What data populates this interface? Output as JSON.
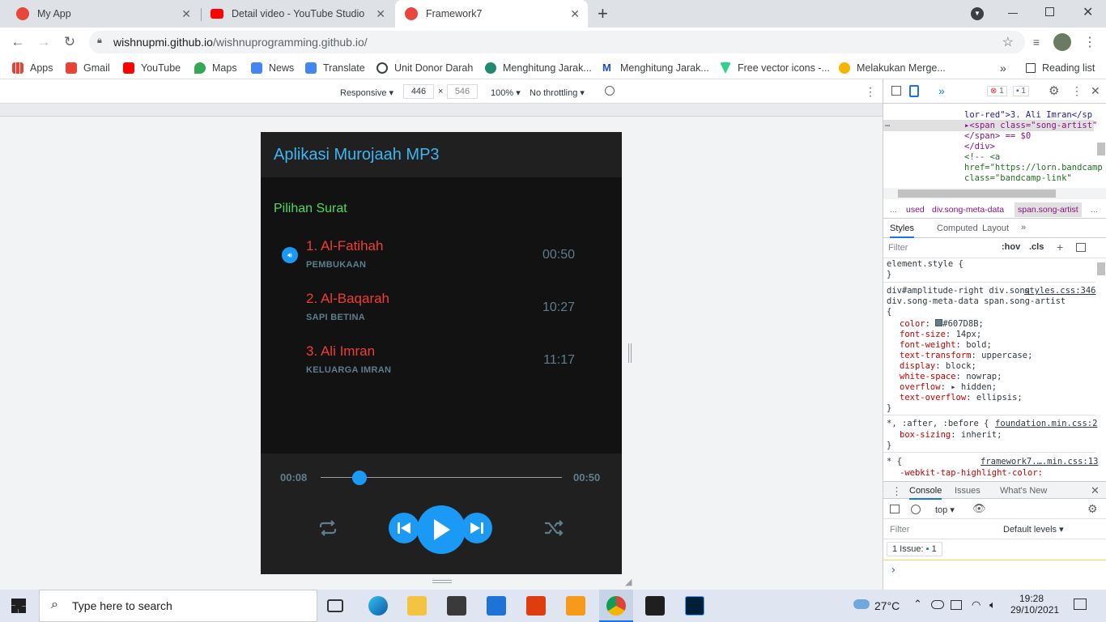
{
  "browser": {
    "tabs": [
      {
        "title": "My App",
        "active": false
      },
      {
        "title": "Detail video - YouTube Studio",
        "active": false
      },
      {
        "title": "Framework7",
        "active": true
      }
    ],
    "new_tab": "+",
    "url_host": "wishnupmi.github.io",
    "url_path": "/wishnuprogramming.github.io/",
    "bookmarks": [
      "Apps",
      "Gmail",
      "YouTube",
      "Maps",
      "News",
      "Translate",
      "Unit Donor Darah",
      "Menghitung Jarak...",
      "Menghitung Jarak...",
      "Free vector icons -...",
      "Melakukan Merge..."
    ],
    "bookmarks_more": "»",
    "reading_list": "Reading list"
  },
  "device_toolbar": {
    "mode": "Responsive ▾",
    "width": "446",
    "times": "×",
    "height": "546",
    "zoom": "100% ▾",
    "throttle": "No throttling ▾"
  },
  "app": {
    "title": "Aplikasi Murojaah MP3",
    "section": "Pilihan Surat",
    "songs": [
      {
        "title": "1. Al-Fatihah",
        "artist": "PEMBUKAAN",
        "duration": "00:50",
        "playing": true
      },
      {
        "title": "2. Al-Baqarah",
        "artist": "SAPI BETINA",
        "duration": "10:27",
        "playing": false
      },
      {
        "title": "3. Ali Imran",
        "artist": "KELUARGA IMRAN",
        "duration": "11:17",
        "playing": false
      }
    ],
    "player": {
      "current_time": "00:08",
      "total_time": "00:50",
      "progress": 0.16
    }
  },
  "devtools": {
    "errors": "1",
    "messages": "1",
    "dom": [
      "lor-red\">3. Ali Imran</sp",
      "▸<span class=\"song-artist\"",
      "</span> == $0",
      "</div>",
      "<!-- <a",
      "href=\"https://lorn.bandcamp",
      "class=\"bandcamp-link\""
    ],
    "breadcrumbs": [
      "...",
      "used",
      "div.song-meta-data",
      "span.song-artist",
      "..."
    ],
    "tabs": [
      "Styles",
      "Computed",
      "Layout",
      "»"
    ],
    "filter_placeholder": "Filter",
    "hov": ":hov",
    "cls": ".cls",
    "element_style": "element.style {",
    "rule1_source": "styles.css:346",
    "rule1_selector": "div#amplitude-right div.song div.song-meta-data span.song-artist {",
    "rule1_props": [
      {
        "name": "color",
        "value": "#607D8B;"
      },
      {
        "name": "font-size",
        "value": "14px;"
      },
      {
        "name": "font-weight",
        "value": "bold;"
      },
      {
        "name": "text-transform",
        "value": "uppercase;"
      },
      {
        "name": "display",
        "value": "block;"
      },
      {
        "name": "white-space",
        "value": "nowrap;"
      },
      {
        "name": "overflow",
        "value": "▸ hidden;"
      },
      {
        "name": "text-overflow",
        "value": "ellipsis;"
      }
    ],
    "rule2_selector": "*, :after, :before {",
    "rule2_source": "foundation.min.css:2",
    "rule2_prop": {
      "name": "box-sizing",
      "value": "inherit;"
    },
    "rule3_selector": "* {",
    "rule3_source": "framework7.….min.css:13",
    "rule3_prop": "-webkit-tap-highlight-color:",
    "close_brace": "}",
    "drawer_tabs": [
      "Console",
      "Issues",
      "What's New"
    ],
    "context": "top ▾",
    "console_filter": "Filter",
    "levels": "Default levels ▾",
    "issues_label": "1 Issue:",
    "issues_count": "1",
    "prompt": "›"
  },
  "taskbar": {
    "search_placeholder": "Type here to search",
    "weather": "27°C",
    "time": "19:28",
    "date": "29/10/2021"
  },
  "colors": {
    "accent_blue": "#1a9af5",
    "title_blue": "#3db6f2",
    "song_red": "#f23c34",
    "section_green": "#4cd964",
    "meta_gray": "#607d8b"
  }
}
